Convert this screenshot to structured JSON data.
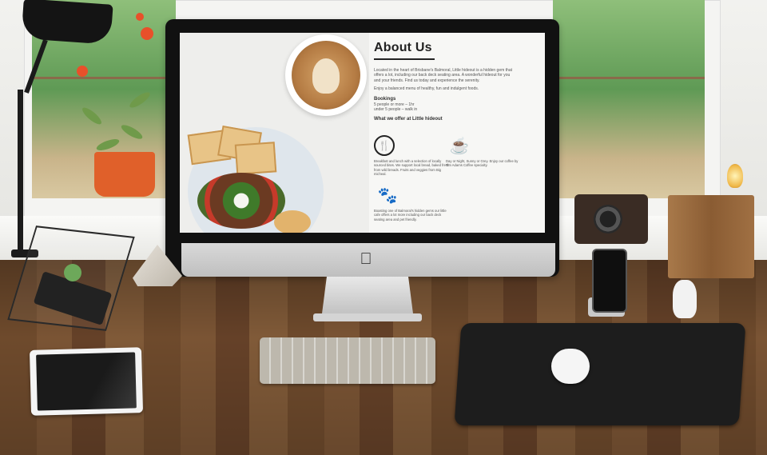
{
  "about": {
    "title": "About Us",
    "paragraph1": "Located in the heart of Brisbane's Balmoral, Little hideout is a hidden gem that offers a lot, including our back deck seating area. A wonderful hideout for you and your friends. Find us today and experience the serenity.",
    "paragraph2": "Enjoy a balanced menu of healthy, fun and indulgent foods."
  },
  "bookings": {
    "heading": "Bookings",
    "lines": [
      "5 people or more – 1hr",
      "under 5 people – walk in"
    ]
  },
  "offer": {
    "heading": "What we offer at Little hideout",
    "items": [
      {
        "icon": "cutlery-icon",
        "text": "Breakfast and lunch with a selection of locally sourced bites. We support local bread, baked fresh from wild breads. Fruits and veggies from Big micheal."
      },
      {
        "icon": "coffee-cup-icon",
        "text": "Day or Night, Sunny or Grey. Enjoy our coffee by Tim Adams Coffee specialty."
      },
      {
        "icon": "paw-icon",
        "text": "Boasting one of Balmoral's hidden gems our little cafe offers a lot more including our back deck seating area and pet friendly."
      }
    ]
  },
  "colors": {
    "screen_bg": "#f7f7f5",
    "title_text": "#222222",
    "body_text": "#555555"
  }
}
